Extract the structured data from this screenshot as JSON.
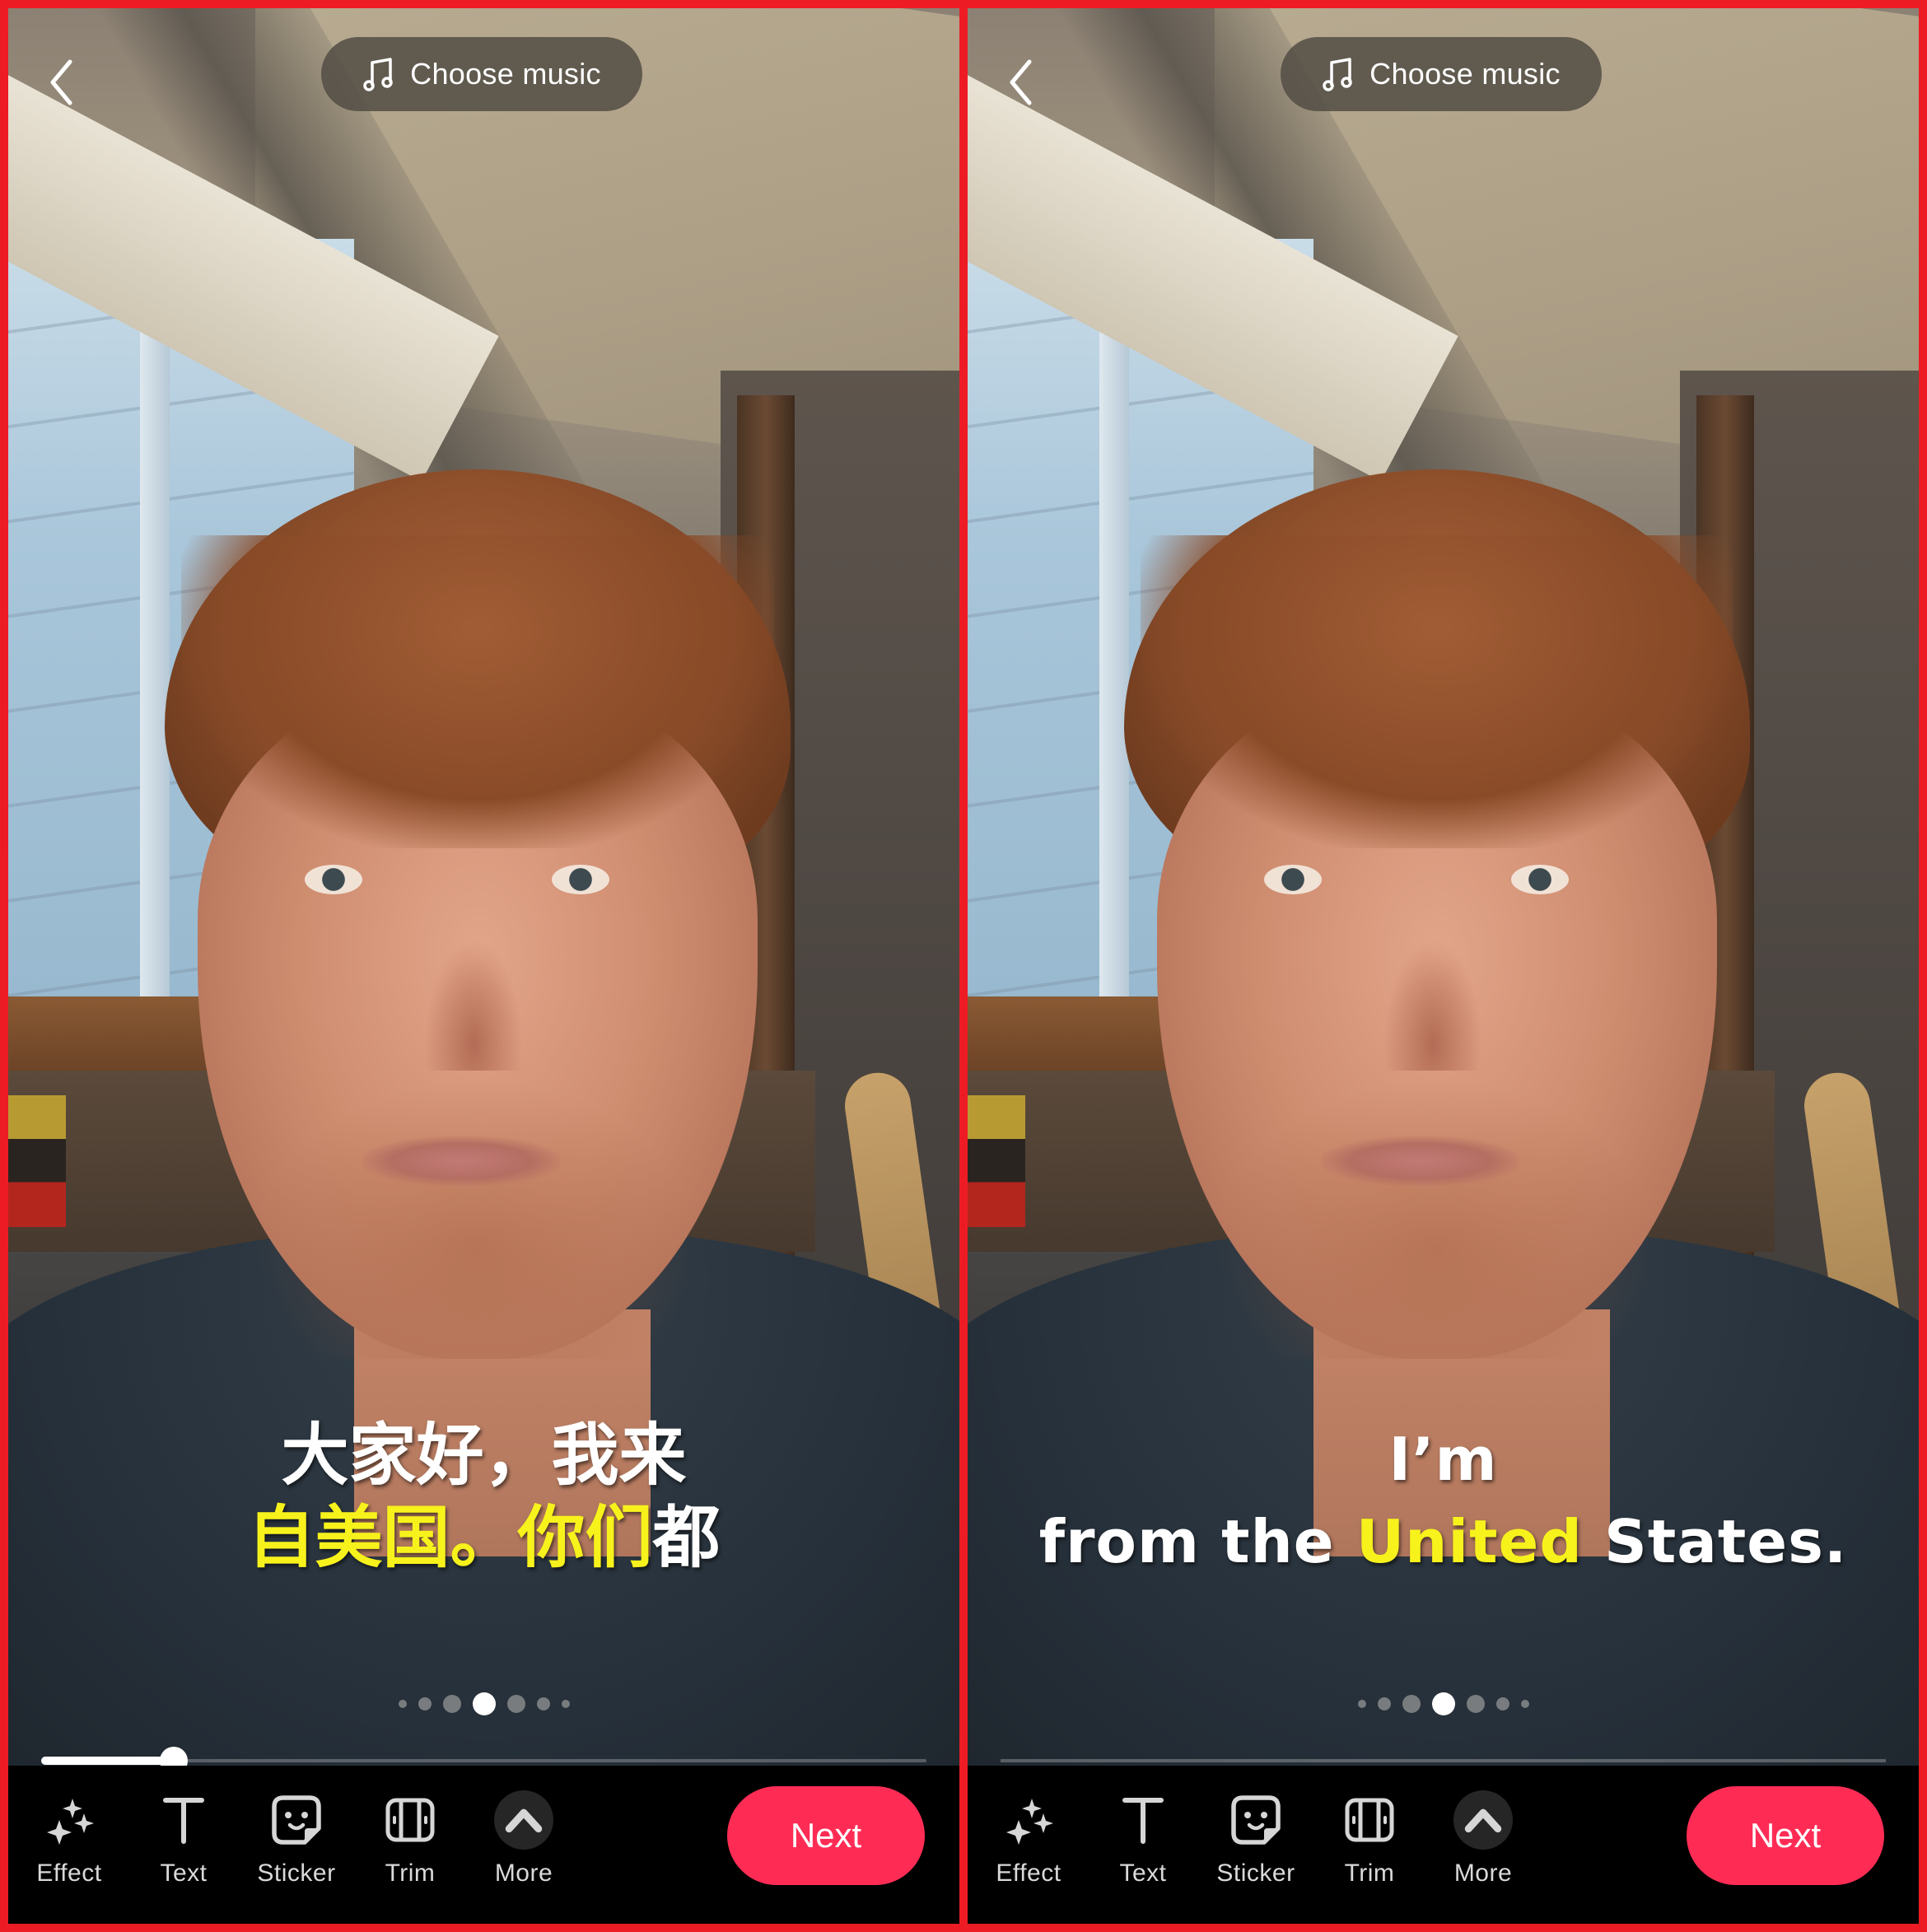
{
  "colors": {
    "frame": "#ED1C24",
    "accent_next": "#FE2C55",
    "subtitle_white": "#FFFFFF",
    "subtitle_yellow": "#F7F21C",
    "toolbar_bg": "#000000",
    "more_circle": "#262626"
  },
  "panels": [
    {
      "top": {
        "back_icon": "chevron-left-icon",
        "music_icon": "music-note-icon",
        "music_label": "Choose music"
      },
      "subtitle": {
        "language": "zh",
        "lines": [
          [
            {
              "text": "大家好，我来",
              "color": "white"
            }
          ],
          [
            {
              "text": "自美国。你们",
              "color": "yellow"
            },
            {
              "text": "都",
              "color": "white"
            }
          ]
        ]
      },
      "pager": {
        "count": 7,
        "active_index": 3
      },
      "progress": {
        "visible": true,
        "fraction": 0.15
      },
      "toolbar": {
        "tools": [
          {
            "id": "effect",
            "label": "Effect",
            "icon": "sparkles-icon"
          },
          {
            "id": "text",
            "label": "Text",
            "icon": "text-t-icon"
          },
          {
            "id": "sticker",
            "label": "Sticker",
            "icon": "sticker-face-icon"
          },
          {
            "id": "trim",
            "label": "Trim",
            "icon": "trim-icon"
          },
          {
            "id": "more",
            "label": "More",
            "icon": "chevron-up-icon"
          }
        ],
        "next_label": "Next"
      }
    },
    {
      "top": {
        "back_icon": "chevron-left-icon",
        "music_icon": "music-note-icon",
        "music_label": "Choose music"
      },
      "subtitle": {
        "language": "en",
        "lines": [
          [
            {
              "text": "I’m",
              "color": "white"
            }
          ],
          [
            {
              "text": "from the ",
              "color": "white"
            },
            {
              "text": "United",
              "color": "yellow"
            },
            {
              "text": " States.",
              "color": "white"
            }
          ]
        ]
      },
      "pager": {
        "count": 7,
        "active_index": 3
      },
      "progress": {
        "visible": false
      },
      "toolbar": {
        "tools": [
          {
            "id": "effect",
            "label": "Effect",
            "icon": "sparkles-icon"
          },
          {
            "id": "text",
            "label": "Text",
            "icon": "text-t-icon"
          },
          {
            "id": "sticker",
            "label": "Sticker",
            "icon": "sticker-face-icon"
          },
          {
            "id": "trim",
            "label": "Trim",
            "icon": "trim-icon"
          },
          {
            "id": "more",
            "label": "More",
            "icon": "chevron-up-icon"
          }
        ],
        "next_label": "Next"
      }
    }
  ]
}
